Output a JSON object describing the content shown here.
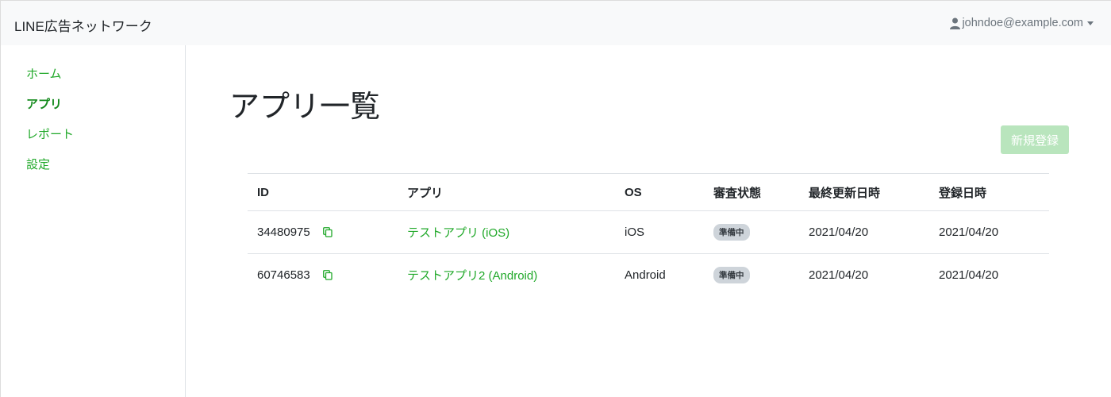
{
  "header": {
    "brand": "LINE広告ネットワーク",
    "user_email": "johndoe@example.com"
  },
  "sidebar": {
    "items": [
      {
        "label": "ホーム",
        "active": false
      },
      {
        "label": "アプリ",
        "active": true
      },
      {
        "label": "レポート",
        "active": false
      },
      {
        "label": "設定",
        "active": false
      }
    ]
  },
  "main": {
    "title": "アプリ一覧",
    "new_button_label": "新規登録",
    "table": {
      "columns": [
        "ID",
        "アプリ",
        "OS",
        "審査状態",
        "最終更新日時",
        "登録日時"
      ],
      "rows": [
        {
          "id": "34480975",
          "app": "テストアプリ (iOS)",
          "os": "iOS",
          "status": "準備中",
          "updated": "2021/04/20",
          "registered": "2021/04/20"
        },
        {
          "id": "60746583",
          "app": "テストアプリ2 (Android)",
          "os": "Android",
          "status": "準備中",
          "updated": "2021/04/20",
          "registered": "2021/04/20"
        }
      ]
    }
  },
  "colors": {
    "accent": "#1fa828",
    "button_disabled": "#b9e5bd",
    "badge_bg": "#ced4da"
  },
  "icons": {
    "user": "user-icon",
    "caret": "caret-down-icon",
    "copy": "copy-icon"
  }
}
